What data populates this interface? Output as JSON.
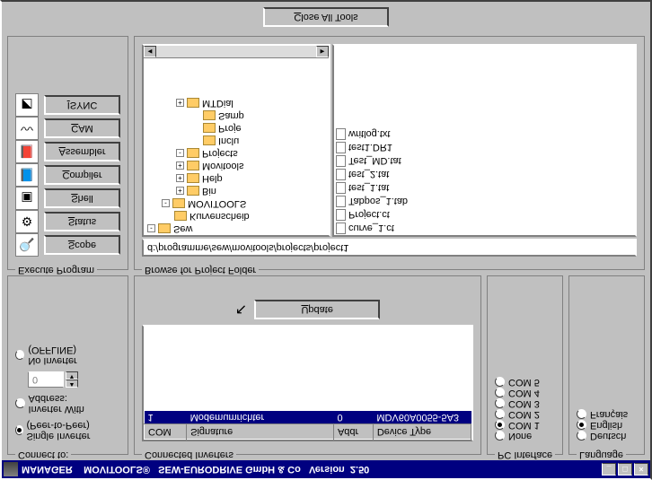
{
  "titlebar": {
    "app": "MANAGER",
    "product": "MOVITOOLS®",
    "company": "SEW-EURODRIVE GmbH & Co",
    "version_label": "Version",
    "version": "2.50"
  },
  "connect": {
    "title": "Connect to:",
    "single_label": "Single Inverter (Peer-to-Peer)",
    "single_selected": true,
    "with_addr_label": "Inverter With Address:",
    "with_addr_selected": false,
    "addr_value": "0",
    "no_inv_label": "No Inverter (OFFLINE)",
    "no_inv_selected": false
  },
  "connected_inverters": {
    "title": "Connected Inverters",
    "cols": [
      "COM",
      "Signature",
      "Addr",
      "Device Type"
    ],
    "rows": [
      {
        "com": "1",
        "signature": "Modemumrichter",
        "addr": "0",
        "device": "MDV60A0055-5A3",
        "selected": true
      }
    ],
    "update_label": "Update"
  },
  "pc_interface": {
    "title": "PC Interface",
    "options": [
      {
        "label": "None",
        "selected": false
      },
      {
        "label": "COM 1",
        "selected": true
      },
      {
        "label": "COM 2",
        "selected": false
      },
      {
        "label": "COM 3",
        "selected": false
      },
      {
        "label": "COM 4",
        "selected": false
      },
      {
        "label": "COM 5",
        "selected": false
      }
    ]
  },
  "language": {
    "title": "Language",
    "options": [
      {
        "label": "Deutsch",
        "selected": false
      },
      {
        "label": "English",
        "selected": true
      },
      {
        "label": "Français",
        "selected": false
      }
    ]
  },
  "execute_program": {
    "title": "Execute Program",
    "tools": [
      {
        "name": "scope",
        "label": "Scope",
        "icon": "🔍"
      },
      {
        "name": "status",
        "label": "Status",
        "icon": "⚙"
      },
      {
        "name": "shell",
        "label": "Shell",
        "icon": "▣"
      },
      {
        "name": "compiler",
        "label": "Compiler",
        "icon": "📘"
      },
      {
        "name": "assembler",
        "label": "Assembler",
        "icon": "📕"
      },
      {
        "name": "cam",
        "label": "CAM",
        "icon": "〰"
      },
      {
        "name": "isync",
        "label": "ISYNC",
        "icon": "◩"
      }
    ]
  },
  "browse": {
    "title": "Browse for Project Folder",
    "path": "d:/programme/sew/movitools/projects/project1",
    "tree": [
      {
        "indent": 0,
        "exp": "-",
        "label": "Sew"
      },
      {
        "indent": 1,
        "exp": "",
        "label": "Kurvenscheib"
      },
      {
        "indent": 1,
        "exp": "-",
        "label": "MOVITOOLS"
      },
      {
        "indent": 2,
        "exp": "+",
        "label": "Bin"
      },
      {
        "indent": 2,
        "exp": "+",
        "label": "Help"
      },
      {
        "indent": 2,
        "exp": "+",
        "label": "Movitools"
      },
      {
        "indent": 2,
        "exp": "-",
        "label": "Projects"
      },
      {
        "indent": 3,
        "exp": "",
        "label": "Inclu"
      },
      {
        "indent": 3,
        "exp": "",
        "label": "Proje"
      },
      {
        "indent": 3,
        "exp": "",
        "label": "Samp"
      },
      {
        "indent": 2,
        "exp": "+",
        "label": "MTDial"
      }
    ],
    "files": [
      {
        "name": "curve_1.ct",
        "type": "data"
      },
      {
        "name": "Project.ct",
        "type": "data"
      },
      {
        "name": "Tabpos_1.tab",
        "type": "file"
      },
      {
        "name": "test_1.tat",
        "type": "file"
      },
      {
        "name": "test_2.tat",
        "type": "file"
      },
      {
        "name": "Test_MD.tat",
        "type": "file"
      },
      {
        "name": "test1.DR1",
        "type": "file"
      },
      {
        "name": "writlog.txt",
        "type": "file"
      }
    ]
  },
  "close_all_label": "Close All Tools"
}
